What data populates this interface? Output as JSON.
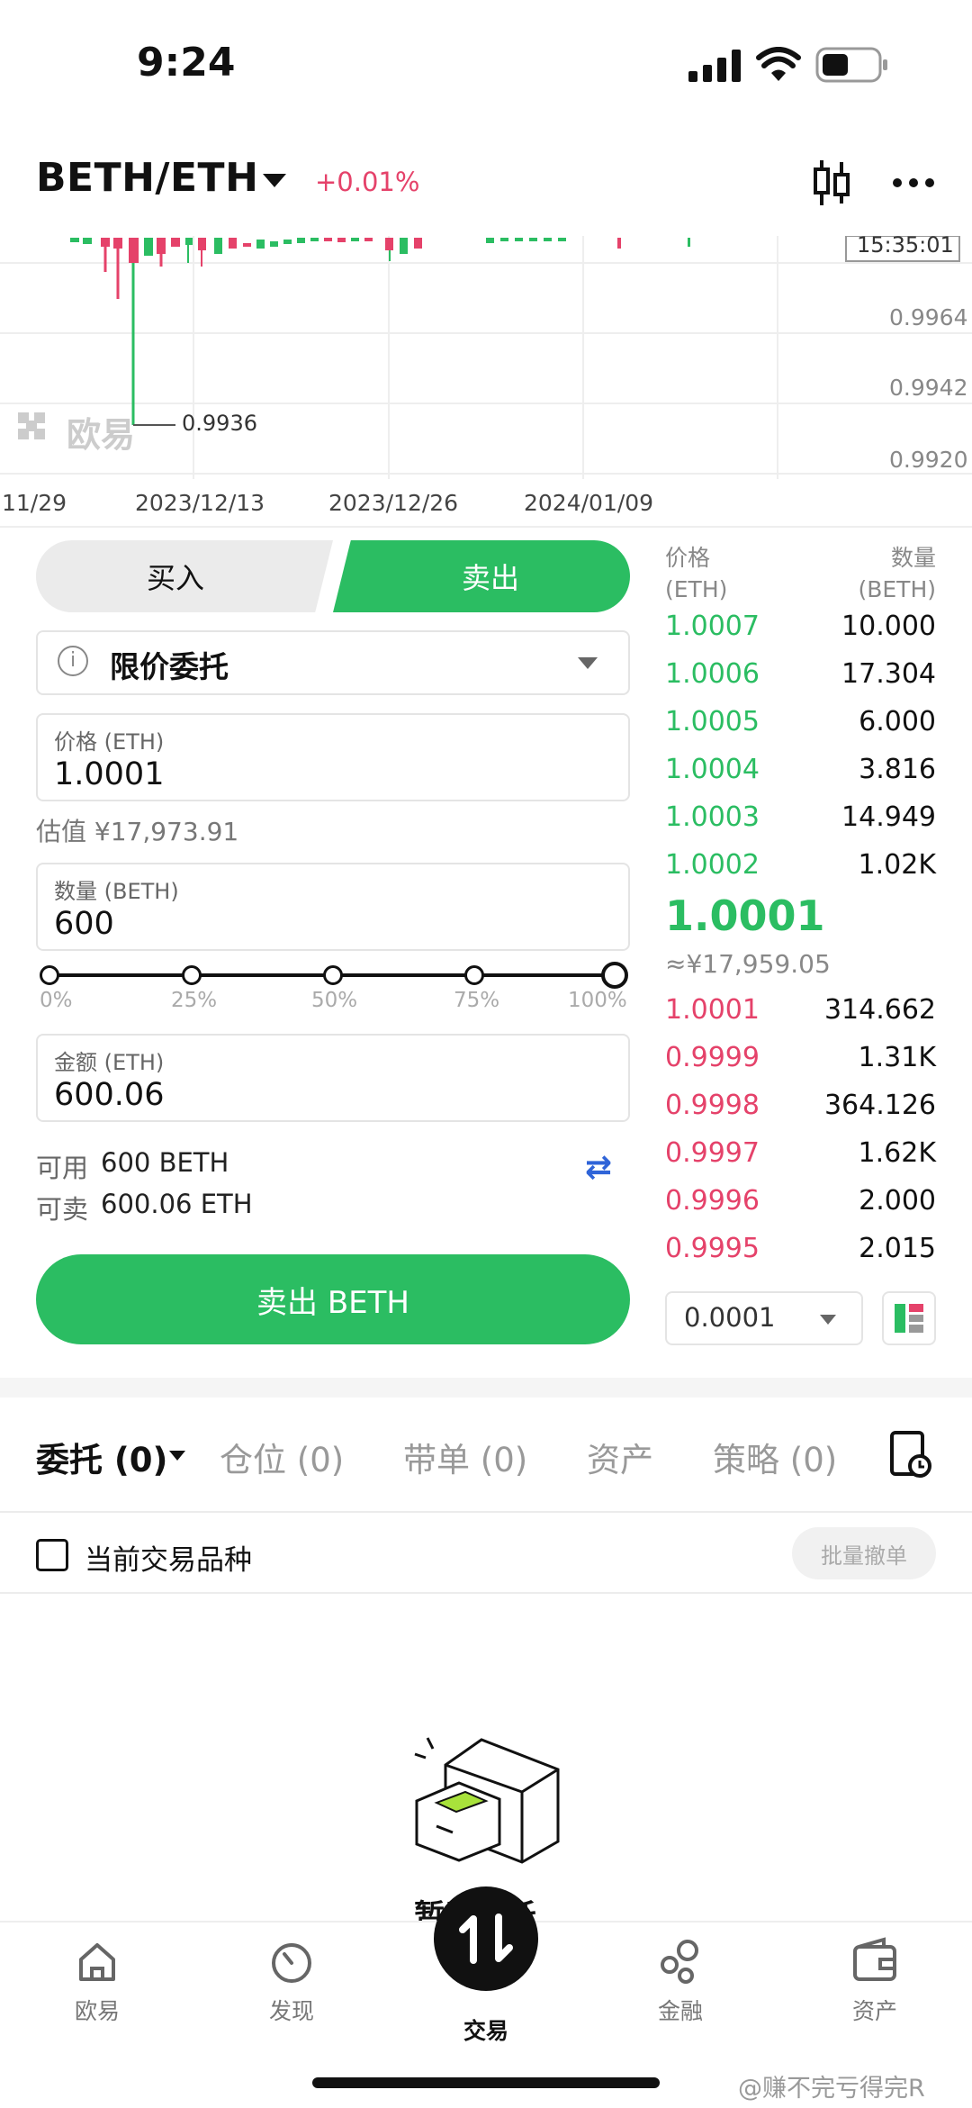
{
  "status_bar": {
    "time": "9:24"
  },
  "header": {
    "pair": "BETH/ETH",
    "change": "+0.01%"
  },
  "chart": {
    "time_tag": "15:35:01",
    "price_labels": [
      "0.9964",
      "0.9942",
      "0.9920"
    ],
    "low_marker": "0.9936",
    "watermark": "欧易",
    "x_labels": [
      "11/29",
      "2023/12/13",
      "2023/12/26",
      "2024/01/09"
    ]
  },
  "trade": {
    "buy_label": "买入",
    "sell_label": "卖出",
    "order_type": "限价委托",
    "price_label": "价格 (ETH)",
    "price_value": "1.0001",
    "estimate": "估值 ¥17,973.91",
    "amount_label": "数量 (BETH)",
    "amount_value": "600",
    "slider_marks": [
      "0%",
      "25%",
      "50%",
      "75%",
      "100%"
    ],
    "slider_value_percent": 100,
    "total_label": "金额 (ETH)",
    "total_value": "600.06",
    "available_label": "可用",
    "available_value": "600 BETH",
    "sellable_label": "可卖",
    "sellable_value": "600.06 ETH",
    "submit_label": "卖出 BETH"
  },
  "order_book": {
    "price_header": "价格",
    "price_unit": "(ETH)",
    "qty_header": "数量",
    "qty_unit": "(BETH)",
    "asks": [
      {
        "price": "1.0007",
        "qty": "10.000"
      },
      {
        "price": "1.0006",
        "qty": "17.304"
      },
      {
        "price": "1.0005",
        "qty": "6.000"
      },
      {
        "price": "1.0004",
        "qty": "3.816"
      },
      {
        "price": "1.0003",
        "qty": "14.949"
      },
      {
        "price": "1.0002",
        "qty": "1.02K"
      }
    ],
    "last_price": "1.0001",
    "last_price_cny": "≈¥17,959.05",
    "bids": [
      {
        "price": "1.0001",
        "qty": "314.662"
      },
      {
        "price": "0.9999",
        "qty": "1.31K"
      },
      {
        "price": "0.9998",
        "qty": "364.126"
      },
      {
        "price": "0.9997",
        "qty": "1.62K"
      },
      {
        "price": "0.9996",
        "qty": "2.000"
      },
      {
        "price": "0.9995",
        "qty": "2.015"
      }
    ],
    "precision": "0.0001"
  },
  "tabs": {
    "items": [
      "委托 (0)",
      "仓位 (0)",
      "带单 (0)",
      "资产",
      "策略 (0)"
    ]
  },
  "filter": {
    "current_pair_label": "当前交易品种",
    "batch_cancel": "批量撤单"
  },
  "empty_state": {
    "label": "暂无委托"
  },
  "bottom_nav": {
    "items": [
      "欧易",
      "发现",
      "交易",
      "金融",
      "资产"
    ]
  },
  "watermark": "@赚不完亏得完R",
  "colors": {
    "green": "#2bbd62",
    "red": "#e5426a",
    "swap_blue": "#2f64d8"
  }
}
